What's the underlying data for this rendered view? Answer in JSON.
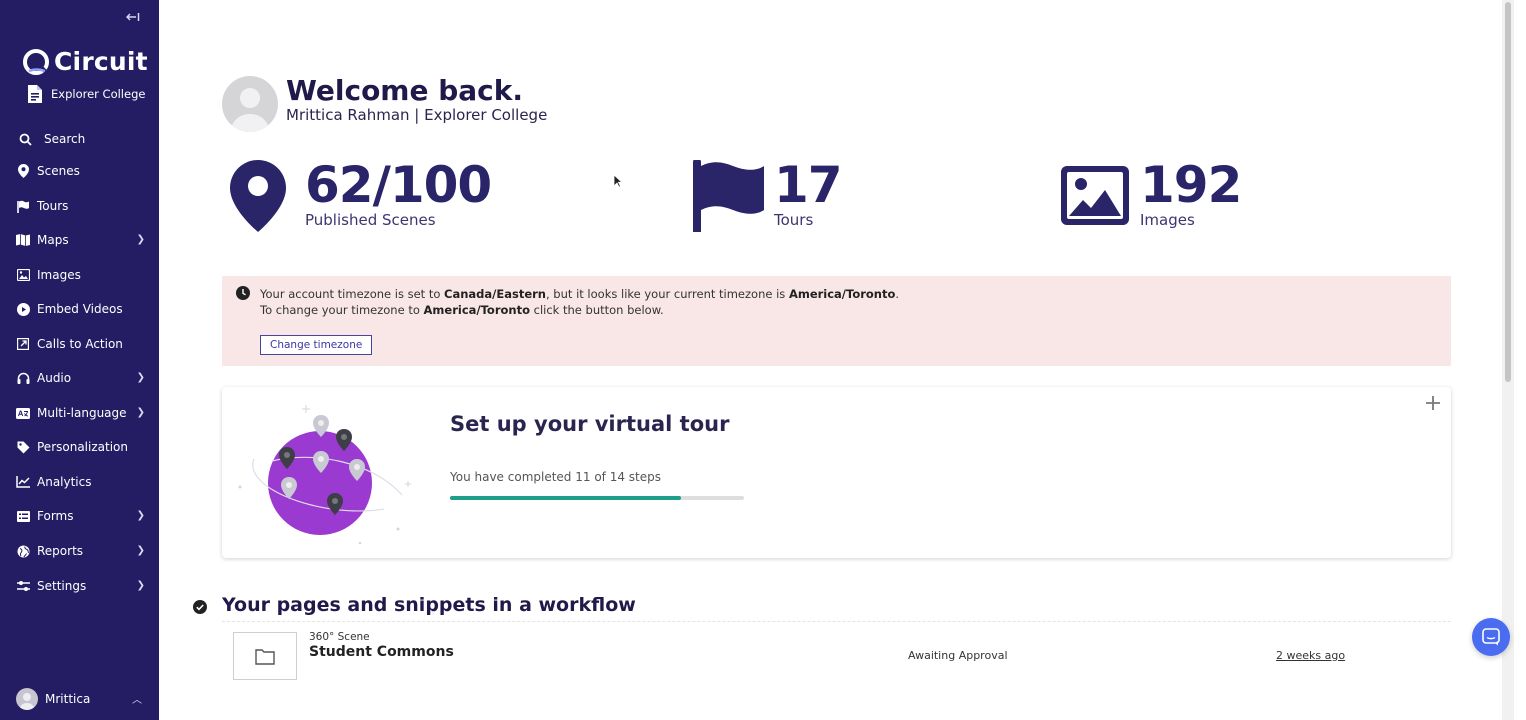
{
  "app": {
    "logo_text": "Circuit",
    "organization": "Explorer College",
    "accent_color": "#241d63"
  },
  "sidebar": {
    "search_label": "Search",
    "items": [
      {
        "label": "Scenes",
        "icon": "map-pin-icon",
        "has_children": false
      },
      {
        "label": "Tours",
        "icon": "flag-icon",
        "has_children": false
      },
      {
        "label": "Maps",
        "icon": "map-icon",
        "has_children": true
      },
      {
        "label": "Images",
        "icon": "image-icon",
        "has_children": false
      },
      {
        "label": "Embed Videos",
        "icon": "play-circle-icon",
        "has_children": false
      },
      {
        "label": "Calls to Action",
        "icon": "external-link-icon",
        "has_children": false
      },
      {
        "label": "Audio",
        "icon": "headphones-icon",
        "has_children": true
      },
      {
        "label": "Multi-language",
        "icon": "language-icon",
        "has_children": true
      },
      {
        "label": "Personalization",
        "icon": "tag-icon",
        "has_children": false
      },
      {
        "label": "Analytics",
        "icon": "chart-line-icon",
        "has_children": false
      },
      {
        "label": "Forms",
        "icon": "list-icon",
        "has_children": true
      },
      {
        "label": "Reports",
        "icon": "globe-icon",
        "has_children": true
      },
      {
        "label": "Settings",
        "icon": "sliders-icon",
        "has_children": true
      }
    ],
    "user_name": "Mrittica"
  },
  "welcome": {
    "title": "Welcome back.",
    "subtitle": "Mrittica Rahman | Explorer College"
  },
  "stats": [
    {
      "value": "62/100",
      "label": "Published Scenes",
      "icon": "map-pin-icon"
    },
    {
      "value": "17",
      "label": "Tours",
      "icon": "flag-icon"
    },
    {
      "value": "192",
      "label": "Images",
      "icon": "image-icon"
    }
  ],
  "timezone_alert": {
    "text_1a": "Your account timezone is set to ",
    "account_tz": "Canada/Eastern",
    "text_1b": ", but it looks like your current timezone is ",
    "current_tz": "America/Toronto",
    "text_1c": ".",
    "text_2a": "To change your timezone to ",
    "target_tz": "America/Toronto",
    "text_2b": " click the button below.",
    "button_label": "Change timezone"
  },
  "tour_setup": {
    "title": "Set up your virtual tour",
    "progress_text": "You have completed 11 of 14 steps",
    "completed_steps": 11,
    "total_steps": 14,
    "progress_color": "#1f9f8a"
  },
  "workflow": {
    "title": "Your pages and snippets in a workflow",
    "rows": [
      {
        "type": "360° Scene",
        "name": "Student Commons",
        "status": "Awaiting Approval",
        "time": "2 weeks ago"
      }
    ]
  }
}
